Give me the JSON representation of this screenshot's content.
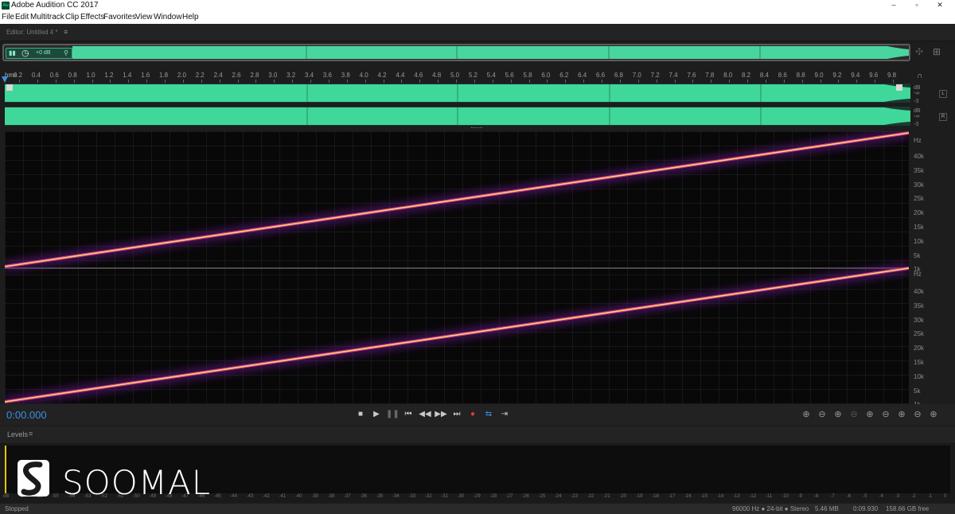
{
  "window": {
    "app_icon": "Au",
    "title": "Adobe Audition CC 2017",
    "minimize": "–",
    "maximize": "▫",
    "close": "✕"
  },
  "menu": [
    "File",
    "Edit",
    "Multitrack",
    "Clip",
    "Effects",
    "Favorites",
    "View",
    "Window",
    "Help"
  ],
  "editor": {
    "tab_label": "Editor: Untitled 4 *",
    "tab_menu_icon": "≡"
  },
  "overview": {
    "db_label": "+0 dB"
  },
  "ruler": {
    "unit": "hms",
    "ticks": [
      "0.2",
      "0.4",
      "0.6",
      "0.8",
      "1.0",
      "1.2",
      "1.4",
      "1.6",
      "1.8",
      "2.0",
      "2.2",
      "2.4",
      "2.6",
      "2.8",
      "3.0",
      "3.2",
      "3.4",
      "3.6",
      "3.8",
      "4.0",
      "4.2",
      "4.4",
      "4.6",
      "4.8",
      "5.0",
      "5.2",
      "5.4",
      "5.6",
      "5.8",
      "6.0",
      "6.2",
      "6.4",
      "6.6",
      "6.8",
      "7.0",
      "7.2",
      "7.4",
      "7.6",
      "7.8",
      "8.0",
      "8.2",
      "8.4",
      "8.6",
      "8.8",
      "9.0",
      "9.2",
      "9.4",
      "9.6",
      "9.8"
    ]
  },
  "channels": [
    {
      "db": "dB",
      "inf": "-∞",
      "minus3": "-3",
      "button": "L"
    },
    {
      "db": "dB",
      "inf": "-∞",
      "minus3": "-3",
      "button": "R"
    }
  ],
  "frequency_axis": {
    "unit": "Hz",
    "upper": [
      "40k",
      "35k",
      "30k",
      "25k",
      "20k",
      "15k",
      "10k",
      "5k",
      "1k"
    ],
    "lower": [
      "40k",
      "35k",
      "30k",
      "25k",
      "20k",
      "15k",
      "10k",
      "5k",
      "1k"
    ]
  },
  "transport": {
    "timecode": "0:00.000",
    "buttons": [
      "■",
      "▶",
      "❚❚",
      "⏮",
      "◀◀",
      "▶▶",
      "⏭",
      "●",
      "⇆",
      "⇥"
    ],
    "zoom_buttons": [
      "⊕",
      "⊖",
      "⊕",
      "⊖",
      "⊕",
      "⊖",
      "⊕",
      "⊖",
      "⊕",
      "⊖"
    ]
  },
  "levels": {
    "title": "Levels",
    "menu_icon": "≡",
    "scale": [
      "dB",
      "-57",
      "-56",
      "-55",
      "-54",
      "-53",
      "-52",
      "-51",
      "-50",
      "-49",
      "-48",
      "-47",
      "-46",
      "-45",
      "-44",
      "-43",
      "-42",
      "-41",
      "-40",
      "-39",
      "-38",
      "-37",
      "-36",
      "-35",
      "-34",
      "-33",
      "-32",
      "-31",
      "-30",
      "-29",
      "-28",
      "-27",
      "-26",
      "-25",
      "-24",
      "-23",
      "-22",
      "-21",
      "-20",
      "-19",
      "-18",
      "-17",
      "-16",
      "-15",
      "-14",
      "-13",
      "-12",
      "-11",
      "-10",
      "-9",
      "-8",
      "-7",
      "-6",
      "-5",
      "-4",
      "-3",
      "-2",
      "-1",
      "0"
    ]
  },
  "watermark": {
    "text": "SOOMAL"
  },
  "status": {
    "state": "Stopped",
    "format": "96000 Hz ● 24-bit ● Stereo",
    "size": "5.46 MB",
    "duration": "0:09.930",
    "free": "158.66 GB free"
  },
  "colors": {
    "waveform": "#3fd89a",
    "accent": "#3b8fe6",
    "record": "#e23b3b"
  }
}
